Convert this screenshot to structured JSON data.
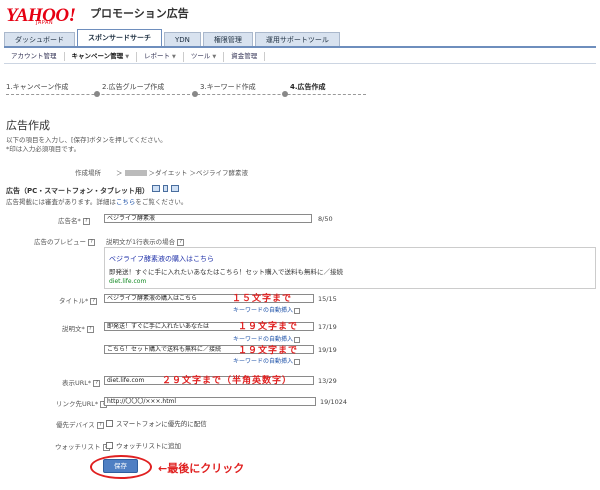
{
  "header": {
    "logo_text": "YAHOO!",
    "logo_sub": "JAPAN",
    "product_name": "プロモーション広告",
    "brand_color": "#e60012"
  },
  "tabs": [
    {
      "label": "ダッシュボード",
      "active": false
    },
    {
      "label": "スポンサードサーチ",
      "active": true
    },
    {
      "label": "YDN",
      "active": false
    },
    {
      "label": "権限管理",
      "active": false
    },
    {
      "label": "運用サポートツール",
      "active": false
    }
  ],
  "subnav": [
    {
      "label": "アカウント管理",
      "strong": false,
      "dropdown": false
    },
    {
      "label": "キャンペーン管理",
      "strong": true,
      "dropdown": true
    },
    {
      "label": "レポート",
      "strong": false,
      "dropdown": true
    },
    {
      "label": "ツール",
      "strong": false,
      "dropdown": true
    },
    {
      "label": "資金管理",
      "strong": false,
      "dropdown": false
    }
  ],
  "steps": [
    {
      "label": "1.キャンペーン作成",
      "current": false
    },
    {
      "label": "2.広告グループ作成",
      "current": false
    },
    {
      "label": "3.キーワード作成",
      "current": false
    },
    {
      "label": "4.広告作成",
      "current": true
    }
  ],
  "page": {
    "title": "広告作成",
    "desc_line1": "以下の項目を入力し、[保存]ボタンを押してください。",
    "desc_line2": "*印は入力必須項目です。",
    "location_label": "作成場所",
    "location_path_prefix": "＞",
    "location_path_suffix": "＞ダイエット ＞ベジライフ酵素液"
  },
  "ad_section": {
    "title": "広告（PC・スマートフォン・タブレット用）",
    "note_prefix": "広告掲載には審査があります。詳細は",
    "note_link": "こちら",
    "note_suffix": "をご覧ください。"
  },
  "form": {
    "ad_name": {
      "label": "広告名*",
      "value": "ベジライフ酵素液",
      "count": "8/50"
    },
    "preview": {
      "label": "広告のプレビュー",
      "hint": "説明文が1行表示の場合",
      "title": "ベジライフ酵素液の購入はこちら",
      "desc": "即発送！すぐに手に入れたいあなたはこちら！セット購入で送料も無料に／接続",
      "url": "diet.life.com"
    },
    "title": {
      "label": "タイトル*",
      "value": "ベジライフ酵素液の購入はこちら",
      "count": "15/15",
      "note": "１５文字まで",
      "kw_insert": "キーワードの自動挿入"
    },
    "desc1": {
      "label": "説明文*",
      "value": "即発送！すぐに手に入れたいあなたは",
      "count": "17/19",
      "note": "１９文字まで",
      "kw_insert": "キーワードの自動挿入"
    },
    "desc2": {
      "value": "こちら！セット購入で送料も無料に／接続",
      "count": "19/19",
      "note": "１９文字まで",
      "kw_insert": "キーワードの自動挿入"
    },
    "display_url": {
      "label": "表示URL*",
      "value": "diet.life.com",
      "count": "13/29",
      "note": "２９文字まで（半角英数字）"
    },
    "link_url": {
      "label": "リンク先URL*",
      "value": "http://〇〇〇/×××.html",
      "count": "19/1024"
    },
    "device": {
      "label": "優先デバイス",
      "option": "スマートフォンに優先的に配信"
    },
    "watchlist": {
      "label": "ウォッチリスト",
      "option": "ウォッチリストに追加"
    },
    "save_label": "保存",
    "callout": "←最後にクリック",
    "note_color": "#e02020"
  }
}
